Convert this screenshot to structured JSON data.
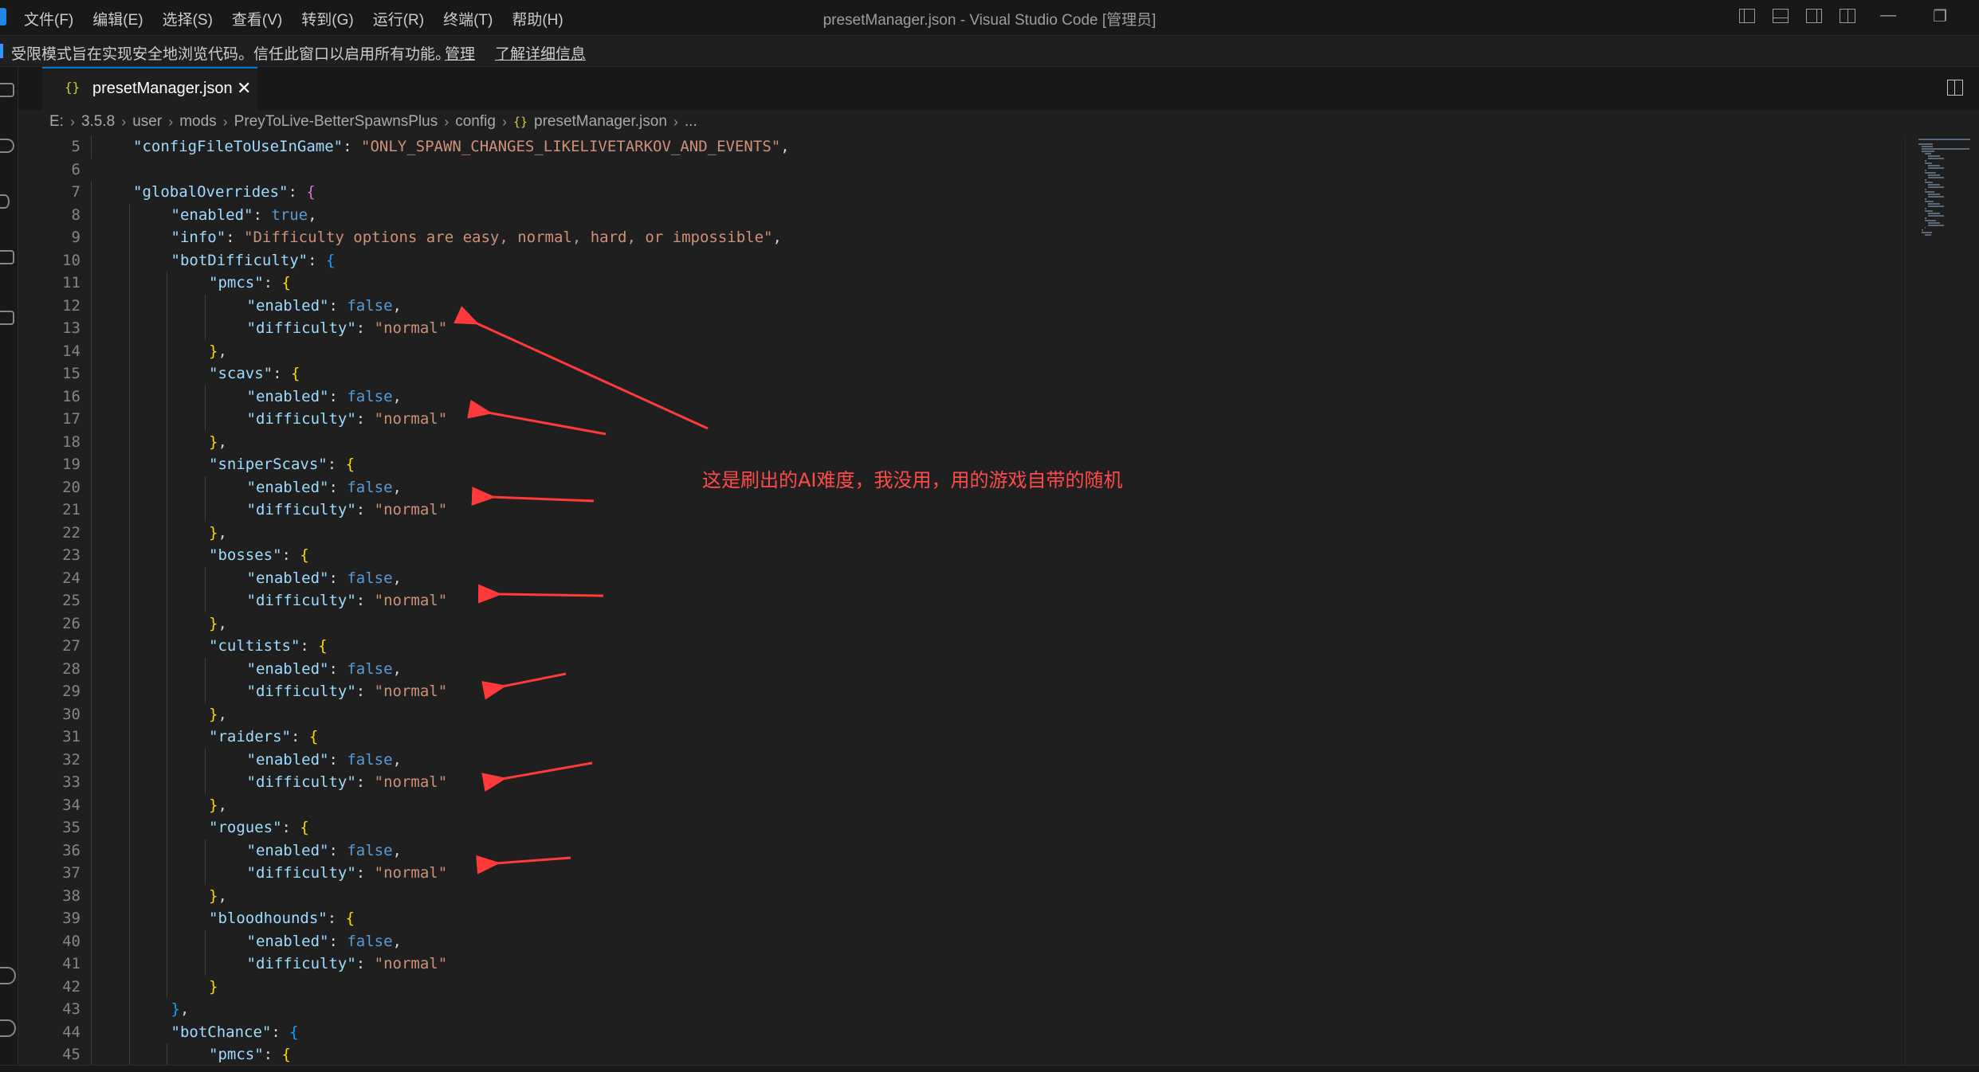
{
  "menu": [
    "文件(F)",
    "编辑(E)",
    "选择(S)",
    "查看(V)",
    "转到(G)",
    "运行(R)",
    "终端(T)",
    "帮助(H)"
  ],
  "window_title": "presetManager.json - Visual Studio Code [管理员]",
  "banner": {
    "text": "受限模式旨在实现安全地浏览代码。信任此窗口以启用所有功能。",
    "manage": "管理",
    "learn_more": "了解详细信息"
  },
  "tab": {
    "icon": "{}",
    "label": "presetManager.json",
    "close": "✕"
  },
  "breadcrumb": [
    "E:",
    "3.5.8",
    "user",
    "mods",
    "PreyToLive-BetterSpawnsPlus",
    "config",
    "presetManager.json",
    "..."
  ],
  "annotation": "这是刷出的AI难度，我没用，用的游戏自带的随机",
  "colors": {
    "key": "#9cdcfe",
    "string": "#ce9178",
    "keyword": "#569cd6",
    "annotation": "#ff3a3a"
  },
  "code": [
    {
      "n": "5",
      "indent": 1,
      "tokens": [
        [
          "k",
          "\"configFileToUseInGame\""
        ],
        [
          "p",
          ": "
        ],
        [
          "s",
          "\"ONLY_SPAWN_CHANGES_LIKELIVETARKOV_AND_EVENTS\""
        ],
        [
          "p",
          ","
        ]
      ]
    },
    {
      "n": "6",
      "indent": 0,
      "tokens": []
    },
    {
      "n": "7",
      "indent": 1,
      "tokens": [
        [
          "k",
          "\"globalOverrides\""
        ],
        [
          "p",
          ": "
        ],
        [
          "m",
          "{"
        ]
      ]
    },
    {
      "n": "8",
      "indent": 2,
      "tokens": [
        [
          "k",
          "\"enabled\""
        ],
        [
          "p",
          ": "
        ],
        [
          "b",
          "true"
        ],
        [
          "p",
          ","
        ]
      ]
    },
    {
      "n": "9",
      "indent": 2,
      "tokens": [
        [
          "k",
          "\"info\""
        ],
        [
          "p",
          ": "
        ],
        [
          "s",
          "\"Difficulty options are easy, normal, hard, or impossible\""
        ],
        [
          "p",
          ","
        ]
      ]
    },
    {
      "n": "10",
      "indent": 2,
      "tokens": [
        [
          "k",
          "\"botDifficulty\""
        ],
        [
          "p",
          ": "
        ],
        [
          "bl",
          "{"
        ]
      ]
    },
    {
      "n": "11",
      "indent": 3,
      "tokens": [
        [
          "k",
          "\"pmcs\""
        ],
        [
          "p",
          ": "
        ],
        [
          "y",
          "{"
        ]
      ]
    },
    {
      "n": "12",
      "indent": 4,
      "tokens": [
        [
          "k",
          "\"enabled\""
        ],
        [
          "p",
          ": "
        ],
        [
          "b",
          "false"
        ],
        [
          "p",
          ","
        ]
      ]
    },
    {
      "n": "13",
      "indent": 4,
      "tokens": [
        [
          "k",
          "\"difficulty\""
        ],
        [
          "p",
          ": "
        ],
        [
          "s",
          "\"normal\""
        ]
      ]
    },
    {
      "n": "14",
      "indent": 3,
      "tokens": [
        [
          "y",
          "}"
        ],
        [
          "p",
          ","
        ]
      ]
    },
    {
      "n": "15",
      "indent": 3,
      "tokens": [
        [
          "k",
          "\"scavs\""
        ],
        [
          "p",
          ": "
        ],
        [
          "y",
          "{"
        ]
      ]
    },
    {
      "n": "16",
      "indent": 4,
      "tokens": [
        [
          "k",
          "\"enabled\""
        ],
        [
          "p",
          ": "
        ],
        [
          "b",
          "false"
        ],
        [
          "p",
          ","
        ]
      ]
    },
    {
      "n": "17",
      "indent": 4,
      "tokens": [
        [
          "k",
          "\"difficulty\""
        ],
        [
          "p",
          ": "
        ],
        [
          "s",
          "\"normal\""
        ]
      ]
    },
    {
      "n": "18",
      "indent": 3,
      "tokens": [
        [
          "y",
          "}"
        ],
        [
          "p",
          ","
        ]
      ]
    },
    {
      "n": "19",
      "indent": 3,
      "tokens": [
        [
          "k",
          "\"sniperScavs\""
        ],
        [
          "p",
          ": "
        ],
        [
          "y",
          "{"
        ]
      ]
    },
    {
      "n": "20",
      "indent": 4,
      "tokens": [
        [
          "k",
          "\"enabled\""
        ],
        [
          "p",
          ": "
        ],
        [
          "b",
          "false"
        ],
        [
          "p",
          ","
        ]
      ]
    },
    {
      "n": "21",
      "indent": 4,
      "tokens": [
        [
          "k",
          "\"difficulty\""
        ],
        [
          "p",
          ": "
        ],
        [
          "s",
          "\"normal\""
        ]
      ]
    },
    {
      "n": "22",
      "indent": 3,
      "tokens": [
        [
          "y",
          "}"
        ],
        [
          "p",
          ","
        ]
      ]
    },
    {
      "n": "23",
      "indent": 3,
      "tokens": [
        [
          "k",
          "\"bosses\""
        ],
        [
          "p",
          ": "
        ],
        [
          "y",
          "{"
        ]
      ]
    },
    {
      "n": "24",
      "indent": 4,
      "tokens": [
        [
          "k",
          "\"enabled\""
        ],
        [
          "p",
          ": "
        ],
        [
          "b",
          "false"
        ],
        [
          "p",
          ","
        ]
      ]
    },
    {
      "n": "25",
      "indent": 4,
      "tokens": [
        [
          "k",
          "\"difficulty\""
        ],
        [
          "p",
          ": "
        ],
        [
          "s",
          "\"normal\""
        ]
      ]
    },
    {
      "n": "26",
      "indent": 3,
      "tokens": [
        [
          "y",
          "}"
        ],
        [
          "p",
          ","
        ]
      ]
    },
    {
      "n": "27",
      "indent": 3,
      "tokens": [
        [
          "k",
          "\"cultists\""
        ],
        [
          "p",
          ": "
        ],
        [
          "y",
          "{"
        ]
      ]
    },
    {
      "n": "28",
      "indent": 4,
      "tokens": [
        [
          "k",
          "\"enabled\""
        ],
        [
          "p",
          ": "
        ],
        [
          "b",
          "false"
        ],
        [
          "p",
          ","
        ]
      ]
    },
    {
      "n": "29",
      "indent": 4,
      "tokens": [
        [
          "k",
          "\"difficulty\""
        ],
        [
          "p",
          ": "
        ],
        [
          "s",
          "\"normal\""
        ]
      ]
    },
    {
      "n": "30",
      "indent": 3,
      "tokens": [
        [
          "y",
          "}"
        ],
        [
          "p",
          ","
        ]
      ]
    },
    {
      "n": "31",
      "indent": 3,
      "tokens": [
        [
          "k",
          "\"raiders\""
        ],
        [
          "p",
          ": "
        ],
        [
          "y",
          "{"
        ]
      ]
    },
    {
      "n": "32",
      "indent": 4,
      "tokens": [
        [
          "k",
          "\"enabled\""
        ],
        [
          "p",
          ": "
        ],
        [
          "b",
          "false"
        ],
        [
          "p",
          ","
        ]
      ]
    },
    {
      "n": "33",
      "indent": 4,
      "tokens": [
        [
          "k",
          "\"difficulty\""
        ],
        [
          "p",
          ": "
        ],
        [
          "s",
          "\"normal\""
        ]
      ]
    },
    {
      "n": "34",
      "indent": 3,
      "tokens": [
        [
          "y",
          "}"
        ],
        [
          "p",
          ","
        ]
      ]
    },
    {
      "n": "35",
      "indent": 3,
      "tokens": [
        [
          "k",
          "\"rogues\""
        ],
        [
          "p",
          ": "
        ],
        [
          "y",
          "{"
        ]
      ]
    },
    {
      "n": "36",
      "indent": 4,
      "tokens": [
        [
          "k",
          "\"enabled\""
        ],
        [
          "p",
          ": "
        ],
        [
          "b",
          "false"
        ],
        [
          "p",
          ","
        ]
      ]
    },
    {
      "n": "37",
      "indent": 4,
      "tokens": [
        [
          "k",
          "\"difficulty\""
        ],
        [
          "p",
          ": "
        ],
        [
          "s",
          "\"normal\""
        ]
      ]
    },
    {
      "n": "38",
      "indent": 3,
      "tokens": [
        [
          "y",
          "}"
        ],
        [
          "p",
          ","
        ]
      ]
    },
    {
      "n": "39",
      "indent": 3,
      "tokens": [
        [
          "k",
          "\"bloodhounds\""
        ],
        [
          "p",
          ": "
        ],
        [
          "y",
          "{"
        ]
      ]
    },
    {
      "n": "40",
      "indent": 4,
      "tokens": [
        [
          "k",
          "\"enabled\""
        ],
        [
          "p",
          ": "
        ],
        [
          "b",
          "false"
        ],
        [
          "p",
          ","
        ]
      ]
    },
    {
      "n": "41",
      "indent": 4,
      "tokens": [
        [
          "k",
          "\"difficulty\""
        ],
        [
          "p",
          ": "
        ],
        [
          "s",
          "\"normal\""
        ]
      ]
    },
    {
      "n": "42",
      "indent": 3,
      "tokens": [
        [
          "y",
          "}"
        ]
      ]
    },
    {
      "n": "43",
      "indent": 2,
      "tokens": [
        [
          "bl",
          "}"
        ],
        [
          "p",
          ","
        ]
      ]
    },
    {
      "n": "44",
      "indent": 2,
      "tokens": [
        [
          "k",
          "\"botChance\""
        ],
        [
          "p",
          ": "
        ],
        [
          "bl",
          "{"
        ]
      ]
    },
    {
      "n": "45",
      "indent": 3,
      "tokens": [
        [
          "k",
          "\"pmcs\""
        ],
        [
          "p",
          ": "
        ],
        [
          "y",
          "{"
        ]
      ]
    }
  ]
}
